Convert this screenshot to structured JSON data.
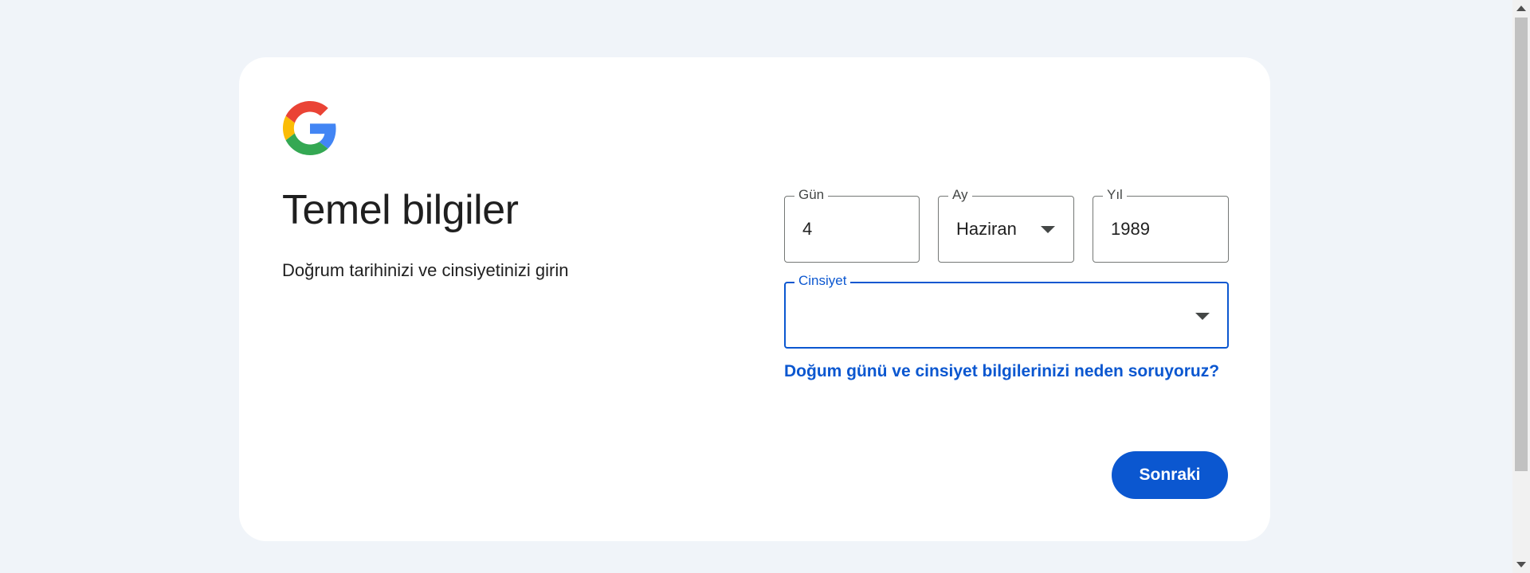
{
  "header": {
    "logo_icon": "google-g-logo",
    "title": "Temel bilgiler",
    "subtitle": "Doğrum tarihinizi ve cinsiyetinizi girin"
  },
  "form": {
    "day": {
      "label": "Gün",
      "value": "4"
    },
    "month": {
      "label": "Ay",
      "value": "Haziran",
      "icon": "chevron-down-icon"
    },
    "year": {
      "label": "Yıl",
      "value": "1989"
    },
    "gender": {
      "label": "Cinsiyet",
      "value": "",
      "icon": "chevron-down-icon",
      "focused": true
    }
  },
  "info_link": "Doğum günü ve cinsiyet bilgilerinizi neden soruyoruz?",
  "actions": {
    "next_label": "Sonraki"
  },
  "colors": {
    "page_background": "#f0f4f9",
    "card_background": "#ffffff",
    "accent": "#0b57d0",
    "text": "#1f1f1f",
    "google_blue": "#4285F4",
    "google_red": "#EA4335",
    "google_yellow": "#FBBC05",
    "google_green": "#34A853"
  }
}
